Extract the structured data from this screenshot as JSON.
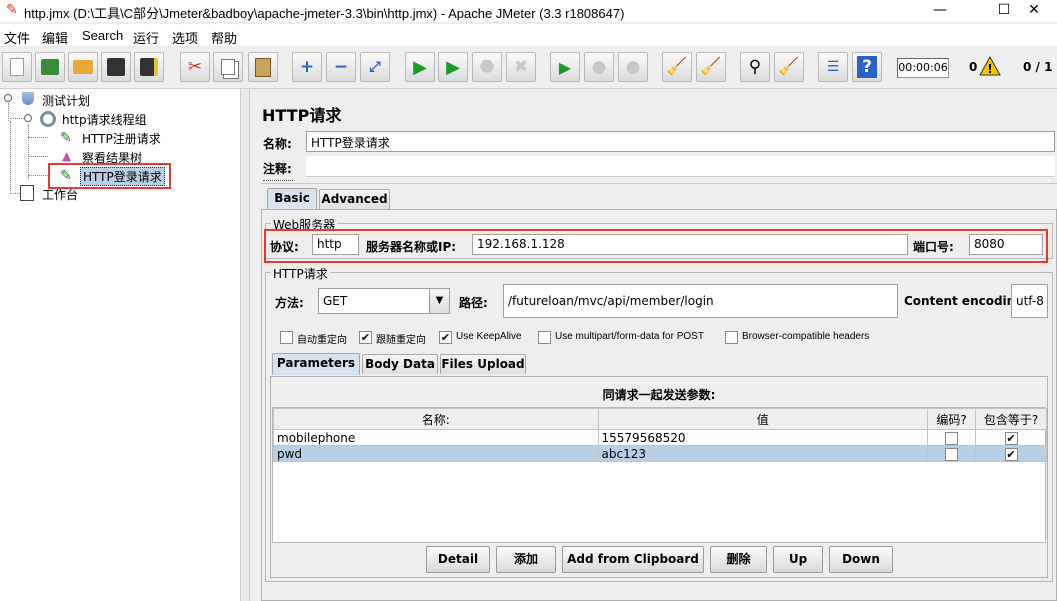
{
  "window": {
    "title": "http.jmx (D:\\工具\\C部分\\Jmeter&badboy\\apache-jmeter-3.3\\bin\\http.jmx) - Apache JMeter (3.3 r1808647)",
    "minimize": "—",
    "maximize": "☐",
    "close": "✕"
  },
  "menu": [
    "文件",
    "编辑",
    "Search",
    "运行",
    "选项",
    "帮助"
  ],
  "toolbar": {
    "icons": [
      "new-icon",
      "templates-icon",
      "open-icon",
      "save-icon",
      "save-as-icon",
      "cut-icon",
      "copy-icon",
      "paste-icon",
      "expand-icon",
      "collapse-icon",
      "toggle-icon",
      "start-icon",
      "start-no-pause-icon",
      "stop-icon",
      "shutdown-icon",
      "remote-start-icon",
      "remote-stop-icon",
      "remote-shutdown-icon",
      "clear-icon",
      "clear-all-icon",
      "search-icon",
      "reset-search-icon",
      "function-helper-icon",
      "help-icon"
    ],
    "timer": "00:00:06",
    "error_count": "0",
    "thread_count": "0 / 1"
  },
  "tree": {
    "test_plan": "测试计划",
    "thread_group": "http请求线程组",
    "http_register": "HTTP注册请求",
    "results_tree": "察看结果树",
    "http_login": "HTTP登录请求",
    "workbench": "工作台"
  },
  "panel": {
    "title": "HTTP请求",
    "name_label": "名称:",
    "name_value": "HTTP登录请求",
    "comment_label": "注释:",
    "tabs": {
      "basic": "Basic",
      "advanced": "Advanced"
    },
    "web_server": {
      "legend": "Web服务器",
      "protocol_label": "协议:",
      "protocol_value": "http",
      "server_label": "服务器名称或IP:",
      "server_value": "192.168.1.128",
      "port_label": "端口号:",
      "port_value": "8080"
    },
    "http_request": {
      "legend": "HTTP请求",
      "method_label": "方法:",
      "method_value": "GET",
      "path_label": "路径:",
      "path_value": "/futureloan/mvc/api/member/login",
      "encoding_label": "Content encoding:",
      "encoding_value": "utf-8"
    },
    "options": [
      {
        "label": "自动重定向",
        "checked": false
      },
      {
        "label": "跟随重定向",
        "checked": true
      },
      {
        "label": "Use KeepAlive",
        "checked": true
      },
      {
        "label": "Use multipart/form-data for POST",
        "checked": false
      },
      {
        "label": "Browser-compatible headers",
        "checked": false
      }
    ],
    "subtabs": {
      "parameters": "Parameters",
      "body_data": "Body Data",
      "files_upload": "Files Upload"
    },
    "params_caption": "同请求一起发送参数:",
    "columns": {
      "name": "名称:",
      "value": "值",
      "encode": "编码?",
      "include_equals": "包含等于?"
    },
    "rows": [
      {
        "name": "mobilephone",
        "value": "15579568520",
        "encode": false,
        "include_equals": true
      },
      {
        "name": "pwd",
        "value": "abc123",
        "encode": false,
        "include_equals": true
      }
    ],
    "buttons": {
      "detail": "Detail",
      "add": "添加",
      "add_clipboard": "Add from Clipboard",
      "delete": "删除",
      "up": "Up",
      "down": "Down"
    }
  }
}
